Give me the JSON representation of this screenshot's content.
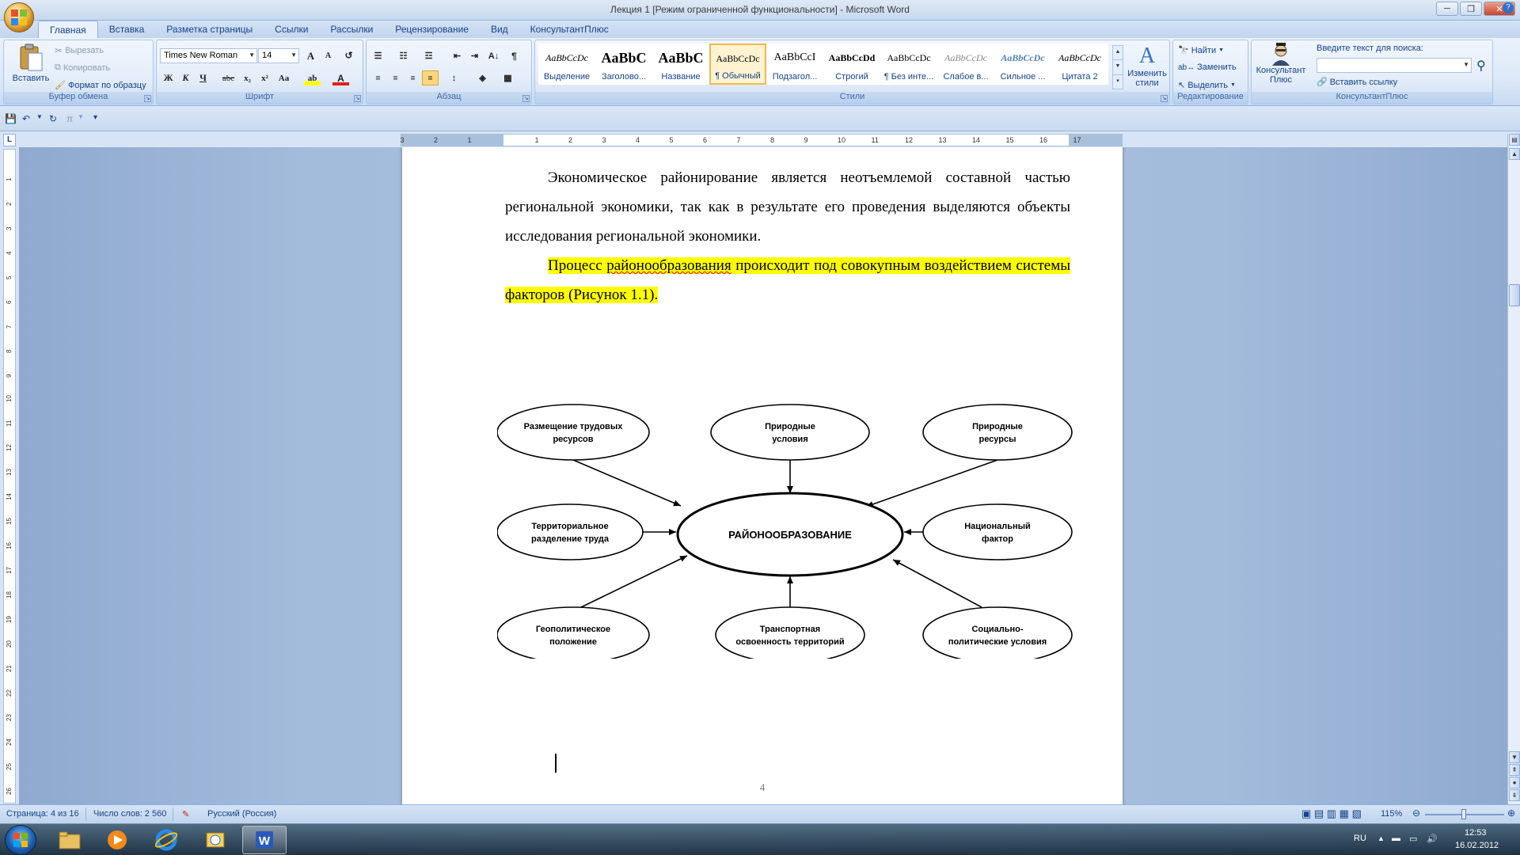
{
  "window": {
    "title": "Лекция 1 [Режим ограниченной функциональности] - Microsoft Word",
    "minimize": "─",
    "maximize": "❐",
    "close": "✕"
  },
  "tabs": [
    "Главная",
    "Вставка",
    "Разметка страницы",
    "Ссылки",
    "Рассылки",
    "Рецензирование",
    "Вид",
    "КонсультантПлюс"
  ],
  "ribbon": {
    "clipboard": {
      "label": "Буфер обмена",
      "paste": "Вставить",
      "cut": "Вырезать",
      "copy": "Копировать",
      "format_painter": "Формат по образцу"
    },
    "font": {
      "label": "Шрифт",
      "font_name": "Times New Roman",
      "font_size": "14",
      "bold": "Ж",
      "italic": "К",
      "underline": "Ч",
      "strike": "abc",
      "subscript": "x₂",
      "superscript": "x²",
      "change_case": "Aa",
      "grow": "A",
      "shrink": "A",
      "font_color": "A",
      "highlight": "ab"
    },
    "paragraph": {
      "label": "Абзац",
      "show_marks": "¶"
    },
    "styles": {
      "label": "Стили",
      "items": [
        {
          "sample": "AaBbCcDc",
          "name": "Выделение"
        },
        {
          "sample": "AaBbC",
          "name": "Заголово..."
        },
        {
          "sample": "AaBbC",
          "name": "Название"
        },
        {
          "sample": "AaBbCcDc",
          "name": "¶ Обычный"
        },
        {
          "sample": "AaBbCcI",
          "name": "Подзагол..."
        },
        {
          "sample": "AaBbCcDd",
          "name": "Строгий"
        },
        {
          "sample": "AaBbCcDc",
          "name": "¶ Без инте..."
        },
        {
          "sample": "AaBbCcDc",
          "name": "Слабое в..."
        },
        {
          "sample": "AaBbCcDc",
          "name": "Сильное ..."
        },
        {
          "sample": "AaBbCcDc",
          "name": "Цитата 2"
        }
      ],
      "change_styles": "Изменить стили"
    },
    "editing": {
      "label": "Редактирование",
      "find": "Найти",
      "replace": "Заменить",
      "select": "Выделить"
    },
    "consultant": {
      "label": "КонсультантПлюс",
      "button": "Консультант Плюс",
      "search_label": "Введите текст для поиска:",
      "insert_link": "Вставить ссылку"
    }
  },
  "ruler": {
    "ticks": [
      "3",
      "2",
      "1",
      "1",
      "2",
      "3",
      "4",
      "5",
      "6",
      "7",
      "8",
      "9",
      "10",
      "11",
      "12",
      "13",
      "14",
      "15",
      "16",
      "17"
    ],
    "vticks": [
      "1",
      "2",
      "3",
      "4",
      "5",
      "6",
      "7",
      "8",
      "9",
      "10",
      "11",
      "12",
      "13",
      "14",
      "15",
      "16",
      "17",
      "18",
      "19",
      "20",
      "21",
      "22",
      "23",
      "24",
      "25",
      "26"
    ],
    "corner": "L"
  },
  "document": {
    "para1": "Экономическое районирование является неотъемлемой составной частью региональной экономики, так как в результате его проведения выделяются объекты исследования региональной экономики.",
    "para2_pre": "Процесс ",
    "para2_wavy": "районообразования",
    "para2_post": " происходит под совокупным воздействием системы факторов (Рисунок 1.1).",
    "page_number": "4"
  },
  "diagram": {
    "center": "РАЙОНООБРАЗОВАНИЕ",
    "nodes": [
      {
        "lines": [
          "Размещение трудовых",
          "ресурсов"
        ]
      },
      {
        "lines": [
          "Природные",
          "условия"
        ]
      },
      {
        "lines": [
          "Природные",
          "ресурсы"
        ]
      },
      {
        "lines": [
          "Территориальное",
          "разделение труда"
        ]
      },
      {
        "lines": [
          "Национальный",
          "фактор"
        ]
      },
      {
        "lines": [
          "Геополитическое",
          "положение"
        ]
      },
      {
        "lines": [
          "Транспортная",
          "освоенность территорий"
        ]
      },
      {
        "lines": [
          "Социально-",
          "политические условия"
        ]
      }
    ]
  },
  "status": {
    "page": "Страница: 4 из 16",
    "words": "Число слов: 2 560",
    "language": "Русский (Россия)",
    "zoom": "115%"
  },
  "taskbar": {
    "lang": "RU",
    "time": "12:53",
    "date": "16.02.2012"
  },
  "colors": {
    "highlight": "#ffff00",
    "ribbon_text": "#15428b",
    "doc_background": "#a9c1df"
  }
}
